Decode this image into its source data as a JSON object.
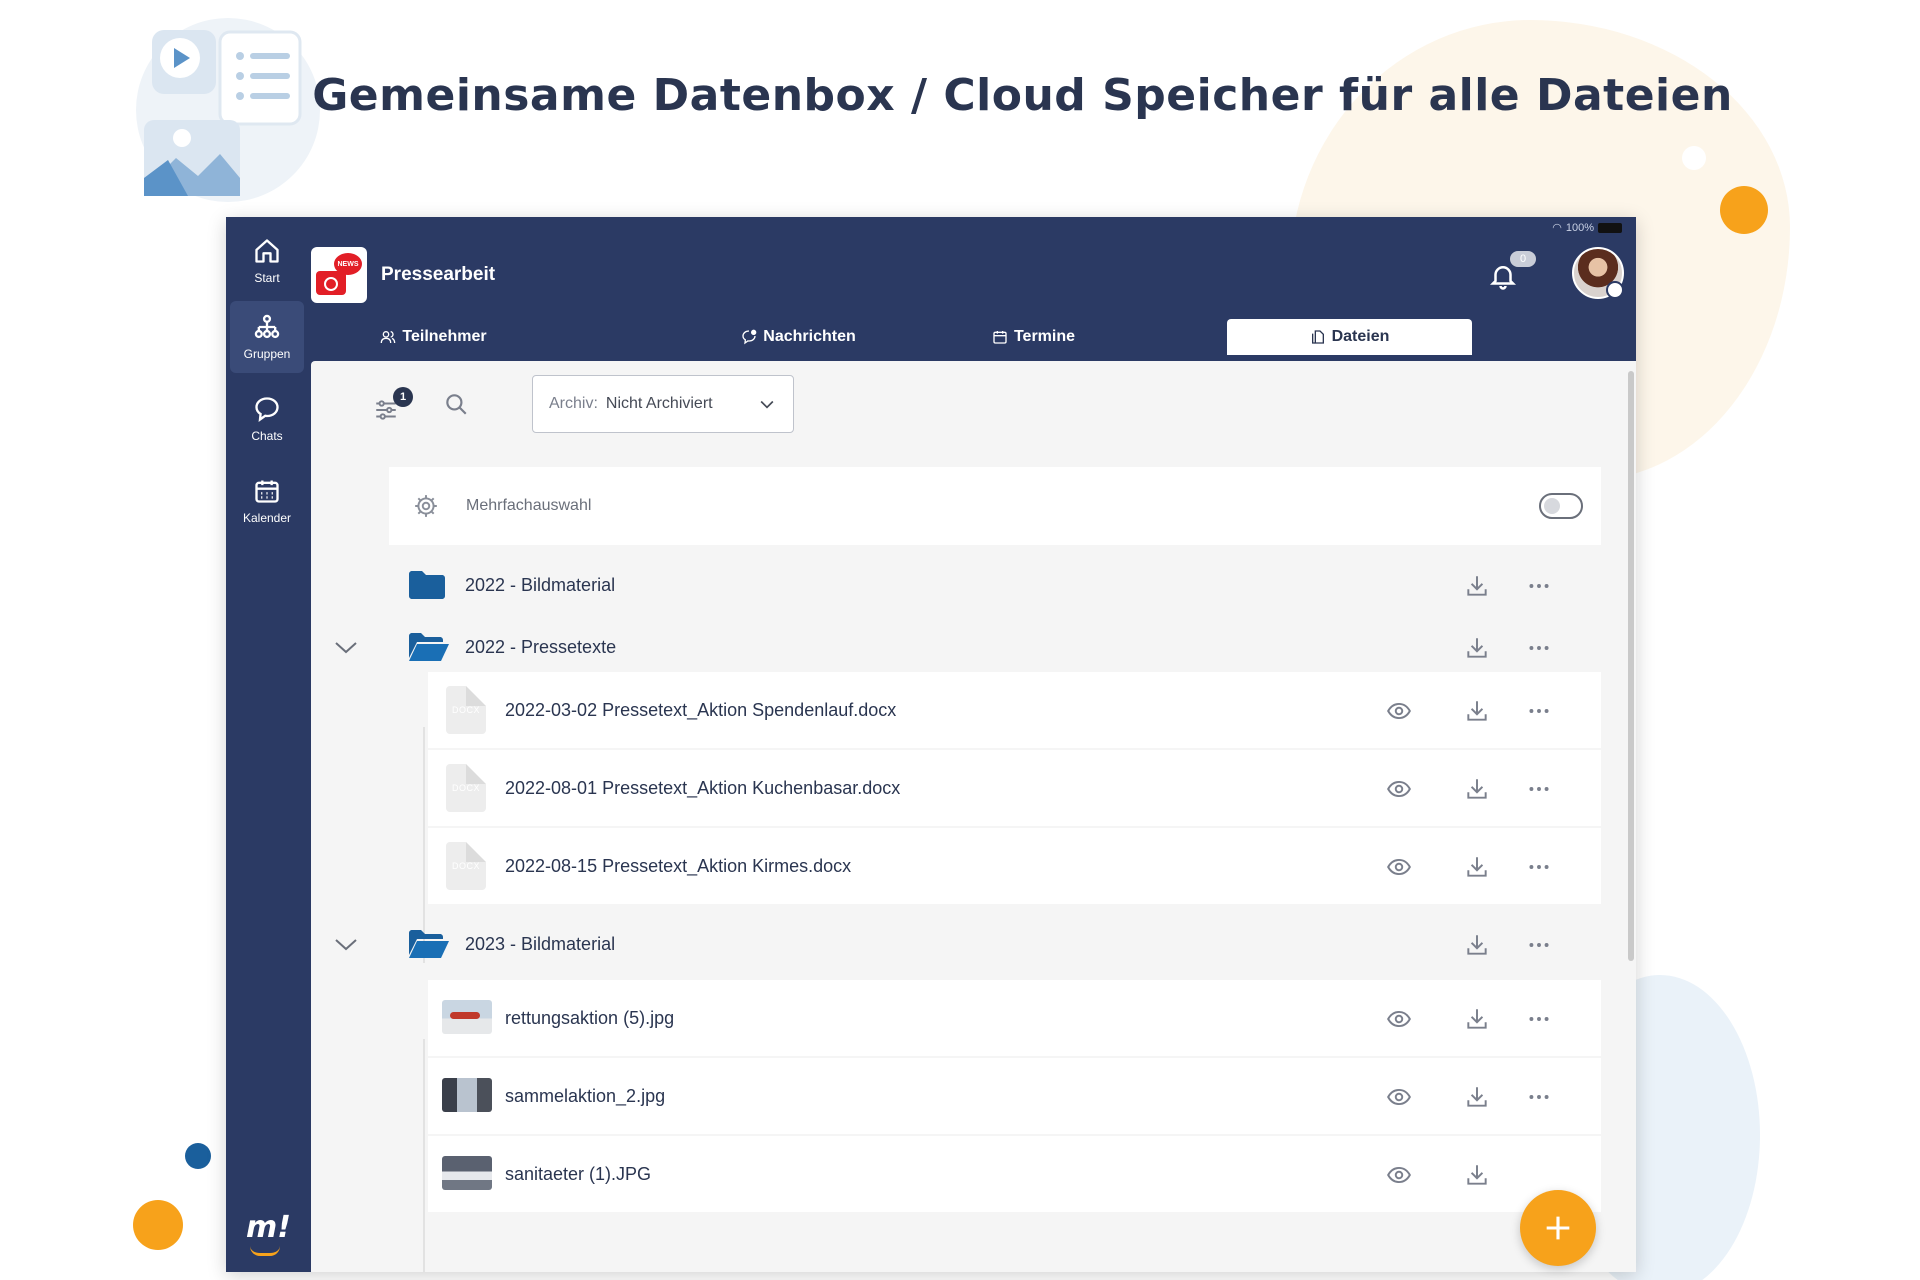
{
  "hero": {
    "title": "Gemeinsame Datenbox / Cloud Speicher für alle Dateien"
  },
  "statusbar": {
    "battery": "100%"
  },
  "sidebar": {
    "items": [
      {
        "label": "Start",
        "icon": "home-icon"
      },
      {
        "label": "Gruppen",
        "icon": "groups-icon",
        "active": true
      },
      {
        "label": "Chats",
        "icon": "chat-bubble-icon"
      },
      {
        "label": "Kalender",
        "icon": "calendar-icon"
      }
    ],
    "brand": "m!"
  },
  "header": {
    "group_name": "Pressearbeit",
    "group_badge": "NEWS",
    "notification_count": "0"
  },
  "tabs": [
    {
      "label": "Teilnehmer",
      "icon": "people-icon"
    },
    {
      "label": "Nachrichten",
      "icon": "message-icon"
    },
    {
      "label": "Termine",
      "icon": "calendar-small-icon"
    },
    {
      "label": "Dateien",
      "icon": "file-icon",
      "active": true
    }
  ],
  "toolbar": {
    "filter_count": "1",
    "archive_label": "Archiv:",
    "archive_value": "Nicht Archiviert"
  },
  "multiselect": {
    "label": "Mehrfachauswahl",
    "enabled": false
  },
  "files": {
    "folder1": {
      "name": "2022 - Bildmaterial",
      "expanded": false
    },
    "folder2": {
      "name": "2022 - Pressetexte",
      "expanded": true,
      "items": [
        {
          "name": "2022-03-02 Pressetext_Aktion Spendenlauf.docx",
          "type": "DOCX"
        },
        {
          "name": "2022-08-01 Pressetext_Aktion Kuchenbasar.docx",
          "type": "DOCX"
        },
        {
          "name": "2022-08-15 Pressetext_Aktion Kirmes.docx",
          "type": "DOCX"
        }
      ]
    },
    "folder3": {
      "name": "2023 - Bildmaterial",
      "expanded": true,
      "items": [
        {
          "name": "rettungsaktion (5).jpg"
        },
        {
          "name": "sammelaktion_2.jpg"
        },
        {
          "name": "sanitaeter (1).JPG"
        }
      ]
    }
  },
  "colors": {
    "navy": "#2b3a64",
    "accent": "#f7a21b",
    "folder": "#1a5f9c"
  }
}
